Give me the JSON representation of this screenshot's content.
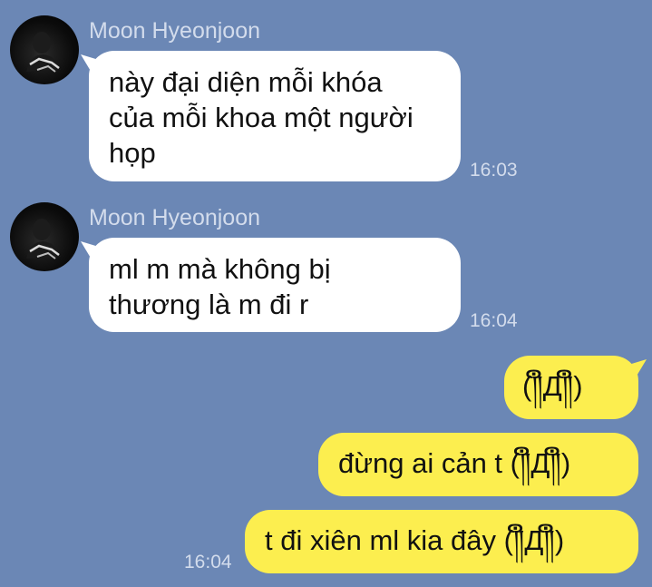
{
  "chat": {
    "messages": [
      {
        "sender": "Moon Hyeonjoon",
        "text": "này đại diện mỗi khóa\ncủa mỗi khoa một người\nhọp",
        "time": "16:03"
      },
      {
        "sender": "Moon Hyeonjoon",
        "text": "ml m mà không bị\nthương là m đi r",
        "time": "16:04"
      }
    ],
    "outgoing": [
      {
        "text": "(༎ຶД༎ຶ)"
      },
      {
        "text": "đừng ai cản t (༎ຶД༎ຶ)"
      },
      {
        "text": "t đi xiên ml kia đây (༎ຶД༎ຶ)",
        "time": "16:04"
      }
    ]
  },
  "colors": {
    "background": "#6b87b5",
    "incoming_bubble": "#ffffff",
    "outgoing_bubble": "#fcee4f",
    "meta_text": "#d3dcec"
  },
  "icons": {
    "avatar": "person-dark-photo"
  }
}
